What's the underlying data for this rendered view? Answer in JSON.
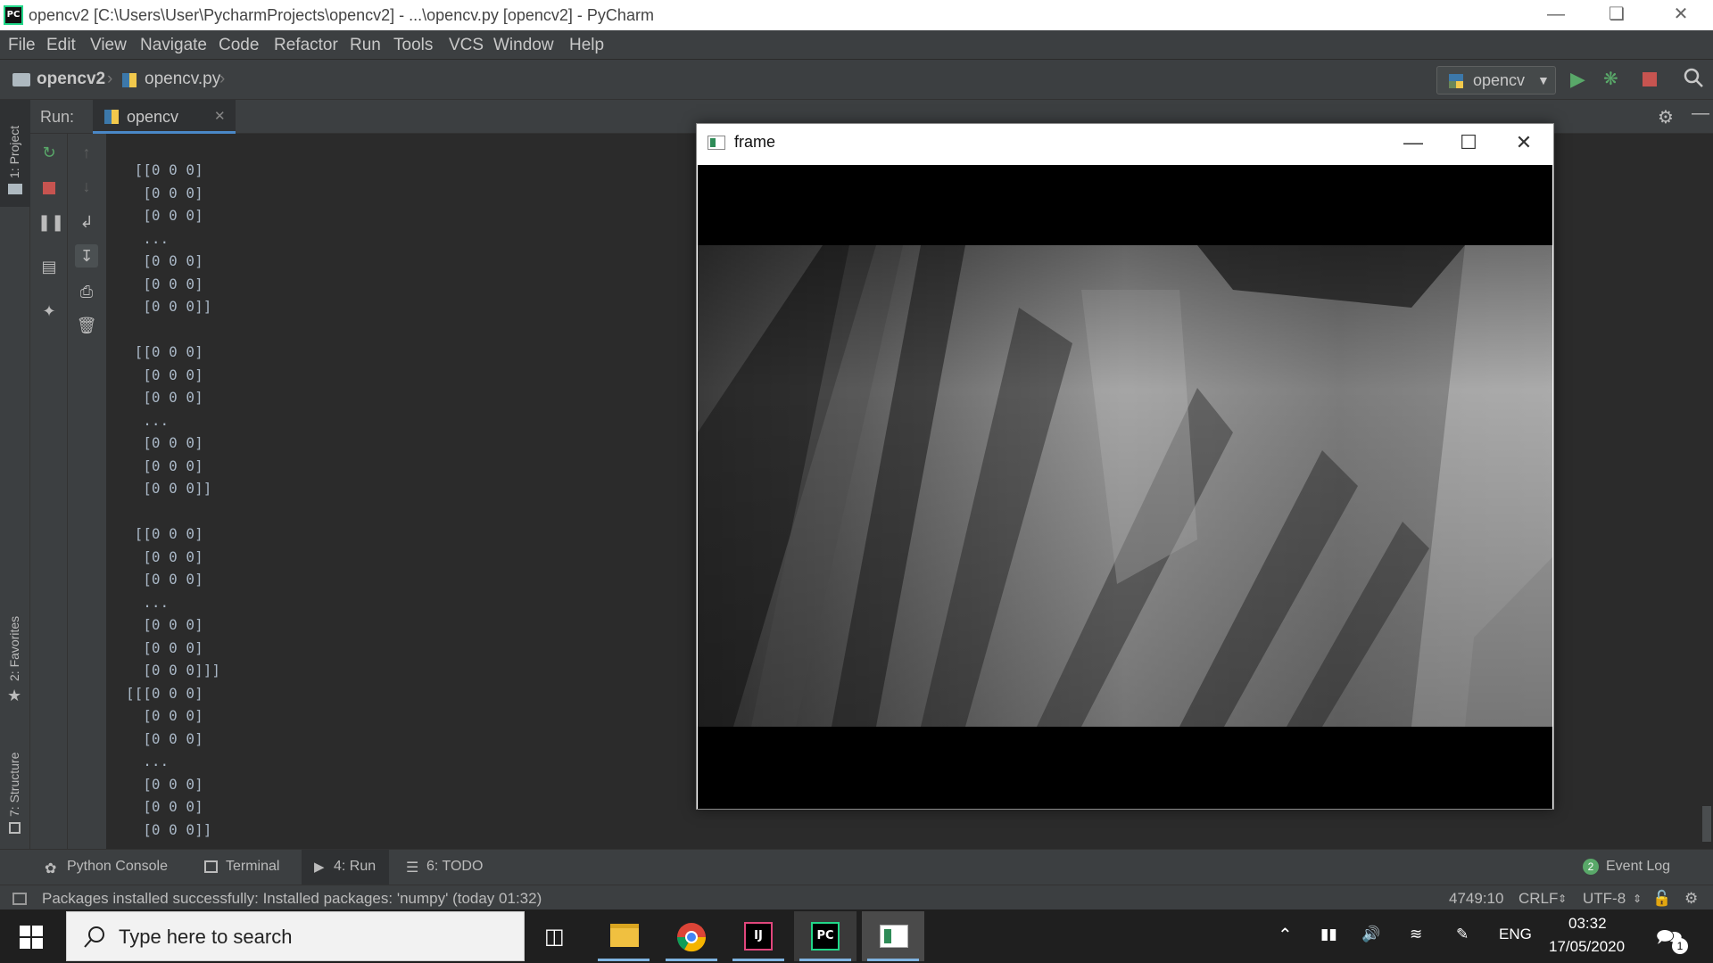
{
  "window": {
    "title": "opencv2 [C:\\Users\\User\\PycharmProjects\\opencv2] - ...\\opencv.py [opencv2] - PyCharm",
    "app_icon_text": "PC"
  },
  "menu": [
    "File",
    "Edit",
    "View",
    "Navigate",
    "Code",
    "Refactor",
    "Run",
    "Tools",
    "VCS",
    "Window",
    "Help"
  ],
  "navbar": {
    "project": "opencv2",
    "file": "opencv.py",
    "run_config": "opencv"
  },
  "left_stripe": {
    "project_tab": "1: Project",
    "favorites_tab": "2: Favorites",
    "structure_tab": "7: Structure"
  },
  "run_panel": {
    "label": "Run:",
    "tab": "opencv",
    "console_text": " [[0 0 0]\n  [0 0 0]\n  [0 0 0]\n  ...\n  [0 0 0]\n  [0 0 0]\n  [0 0 0]]\n\n [[0 0 0]\n  [0 0 0]\n  [0 0 0]\n  ...\n  [0 0 0]\n  [0 0 0]\n  [0 0 0]]\n\n [[0 0 0]\n  [0 0 0]\n  [0 0 0]\n  ...\n  [0 0 0]\n  [0 0 0]\n  [0 0 0]]]\n[[[0 0 0]\n  [0 0 0]\n  [0 0 0]\n  ...\n  [0 0 0]\n  [0 0 0]\n  [0 0 0]]"
  },
  "frame_window": {
    "title": "frame"
  },
  "bottom_tabs": {
    "python_console": "Python Console",
    "terminal": "Terminal",
    "run": "4: Run",
    "todo": "6: TODO",
    "event_log_count": "2",
    "event_log": "Event Log"
  },
  "status": {
    "message": "Packages installed successfully: Installed packages: 'numpy' (today 01:32)",
    "position": "4749:10",
    "line_sep": "CRLF",
    "encoding": "UTF-8"
  },
  "taskbar": {
    "search_placeholder": "Type here to search",
    "language": "ENG",
    "time": "03:32",
    "date": "17/05/2020",
    "notification_count": "1",
    "intellij_label": "IJ",
    "pycharm_label": "PC"
  },
  "colors": {
    "ide_bg": "#2b2b2b",
    "panel_bg": "#3c3f41",
    "console_text": "#a9b7c6",
    "run_green": "#59a869",
    "stop_red": "#c75450"
  }
}
